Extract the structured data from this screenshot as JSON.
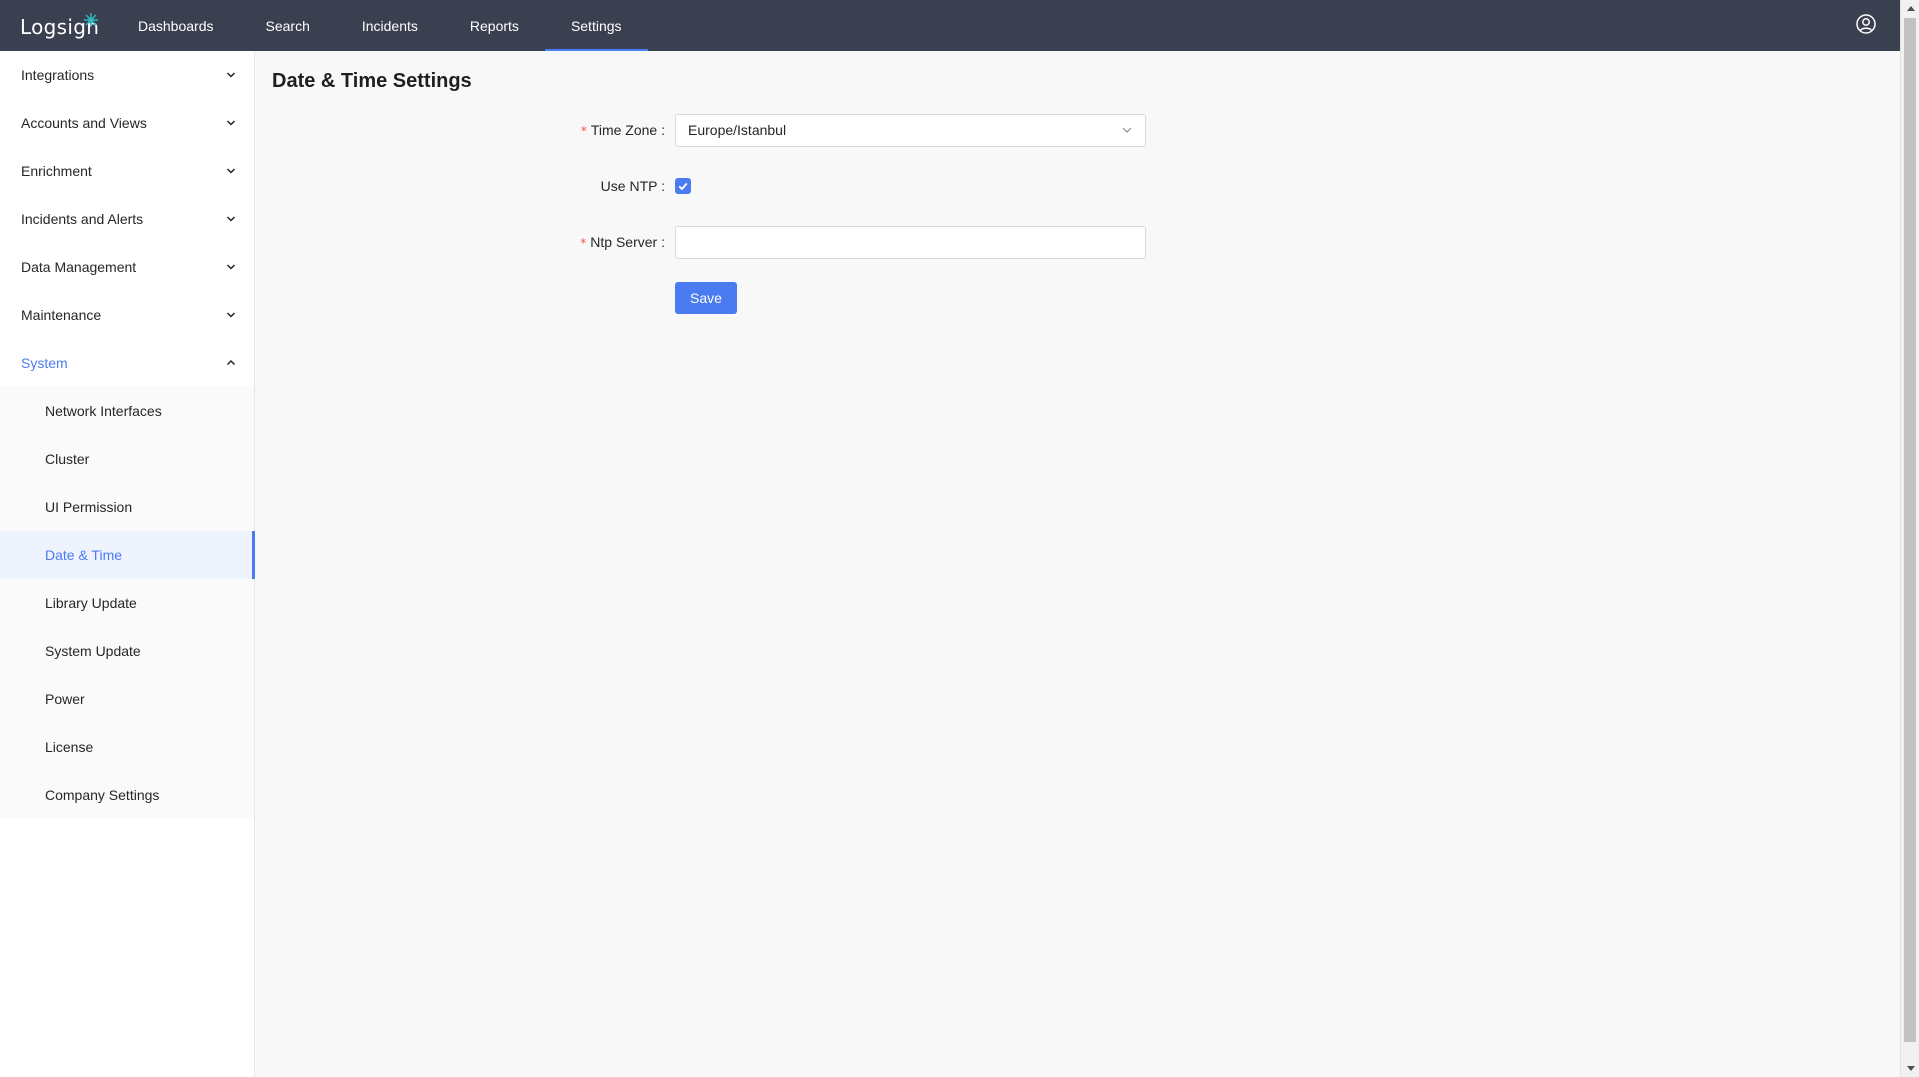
{
  "brand": {
    "name": "Logsign",
    "logo_icon": "logsign-network-icon",
    "accent": "#4a7bf0",
    "topbar_bg": "#3b4051"
  },
  "nav": {
    "items": [
      {
        "label": "Dashboards"
      },
      {
        "label": "Search"
      },
      {
        "label": "Incidents"
      },
      {
        "label": "Reports"
      },
      {
        "label": "Settings",
        "active": true
      }
    ],
    "user_icon": "user-circle-icon"
  },
  "sidebar": {
    "groups": [
      {
        "label": "Integrations",
        "expanded": false
      },
      {
        "label": "Accounts and Views",
        "expanded": false
      },
      {
        "label": "Enrichment",
        "expanded": false
      },
      {
        "label": "Incidents and Alerts",
        "expanded": false
      },
      {
        "label": "Data Management",
        "expanded": false
      },
      {
        "label": "Maintenance",
        "expanded": false
      },
      {
        "label": "System",
        "expanded": true
      }
    ],
    "system_items": [
      {
        "label": "Network Interfaces"
      },
      {
        "label": "Cluster"
      },
      {
        "label": "UI Permission"
      },
      {
        "label": "Date & Time",
        "active": true
      },
      {
        "label": "Library Update"
      },
      {
        "label": "System Update"
      },
      {
        "label": "Power"
      },
      {
        "label": "License"
      },
      {
        "label": "Company Settings"
      }
    ]
  },
  "main": {
    "title": "Date & Time Settings",
    "time_zone": {
      "label": "Time Zone",
      "required": "*",
      "value": "Europe/Istanbul"
    },
    "use_ntp": {
      "label": "Use NTP",
      "checked": true
    },
    "ntp_server": {
      "label": "Ntp Server",
      "required": "*",
      "value": "",
      "placeholder": ""
    },
    "save_label": "Save",
    "colon": ":"
  }
}
